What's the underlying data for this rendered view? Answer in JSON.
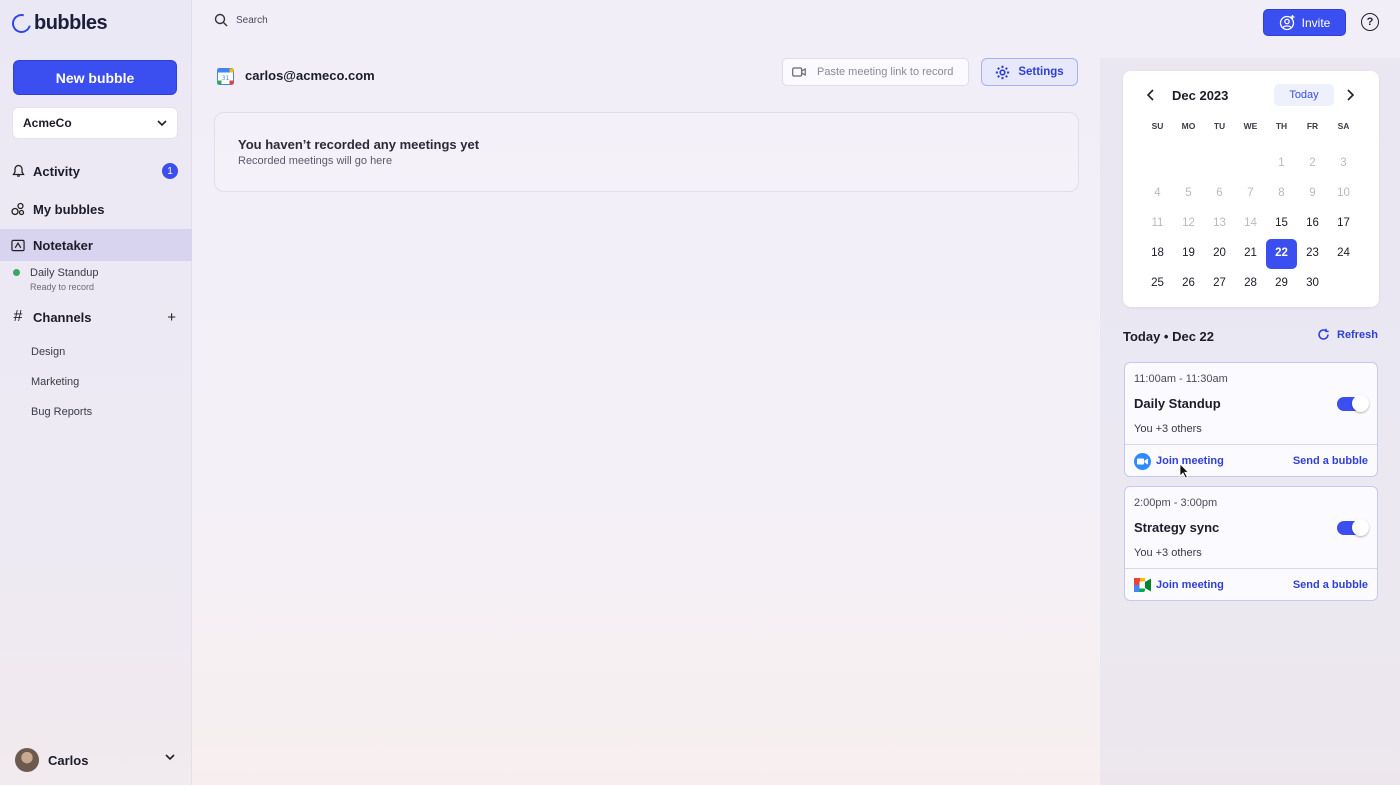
{
  "app": {
    "logo_text": "bubbles",
    "accent": "#3b4ef0"
  },
  "sidebar": {
    "new_bubble_label": "New bubble",
    "workspace": "AcmeCo",
    "items": [
      {
        "label": "Activity",
        "icon": "bell-icon",
        "badge": "1"
      },
      {
        "label": "My bubbles",
        "icon": "bubbles-icon"
      },
      {
        "label": "Notetaker",
        "icon": "notetaker-icon",
        "active": true
      }
    ],
    "notetaker_sub": {
      "label": "Daily Standup",
      "status": "Ready to record"
    },
    "channels_label": "Channels",
    "channels": [
      "Design",
      "Marketing",
      "Bug Reports"
    ],
    "user": "Carlos"
  },
  "topbar": {
    "search_label": "Search",
    "invite_label": "Invite",
    "help_label": "?"
  },
  "main": {
    "account": "carlos@acmeco.com",
    "paste_placeholder": "Paste meeting link to record",
    "settings_label": "Settings",
    "empty_title": "You haven’t recorded any meetings yet",
    "empty_sub": "Recorded meetings will go here"
  },
  "calendar": {
    "month": "Dec 2023",
    "today_label": "Today",
    "weekdays": [
      "SU",
      "MO",
      "TU",
      "WE",
      "TH",
      "FR",
      "SA"
    ],
    "weeks": [
      [
        "",
        "",
        "",
        "",
        "1",
        "2",
        "3"
      ],
      [
        "4",
        "5",
        "6",
        "7",
        "8",
        "9",
        "10"
      ],
      [
        "11",
        "12",
        "13",
        "14",
        "15",
        "16",
        "17"
      ],
      [
        "18",
        "19",
        "20",
        "21",
        "22",
        "23",
        "24"
      ],
      [
        "25",
        "26",
        "27",
        "28",
        "29",
        "30",
        ""
      ]
    ],
    "selected_day": "22",
    "first_active_day": 15
  },
  "agenda": {
    "heading": "Today • Dec 22",
    "refresh_label": "Refresh",
    "meetings": [
      {
        "time": "11:00am - 11:30am",
        "title": "Daily Standup",
        "people": "You +3 others",
        "join_label": "Join meeting",
        "send_label": "Send a bubble",
        "enabled": true,
        "provider": "zoom"
      },
      {
        "time": "2:00pm - 3:00pm",
        "title": "Strategy sync",
        "people": "You +3 others",
        "join_label": "Join meeting",
        "send_label": "Send a bubble",
        "enabled": true,
        "provider": "google-meet"
      }
    ]
  }
}
